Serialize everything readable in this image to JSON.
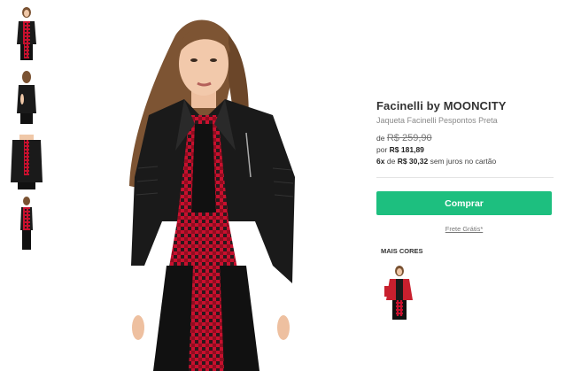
{
  "product": {
    "brand": "Facinelli by MOONCITY",
    "name": "Jaqueta Facinelli Pespontos Preta",
    "price_from_prefix": "de",
    "price_from": "R$ 259,90",
    "price_to_prefix": "por",
    "price_to": "R$ 181,89",
    "installments_count": "6x",
    "installments_de": "de",
    "installments_value": "R$ 30,32",
    "installments_suffix": "sem juros no cartão"
  },
  "actions": {
    "buy_label": "Comprar",
    "shipping_label": "Frete Grátis*"
  },
  "more_colors": {
    "title": "MAIS CORES",
    "items": [
      {
        "icon": "red-jacket-thumbnail"
      }
    ]
  },
  "gallery": {
    "thumbnails": [
      {
        "icon": "front-view-thumbnail"
      },
      {
        "icon": "back-view-thumbnail"
      },
      {
        "icon": "detail-view-thumbnail"
      },
      {
        "icon": "side-view-thumbnail"
      }
    ],
    "main_image": "model-wearing-black-leather-jacket"
  },
  "colors": {
    "accent": "#1dbf7f",
    "jacket": "#1a1a1a",
    "plaid": "#c8102e"
  }
}
